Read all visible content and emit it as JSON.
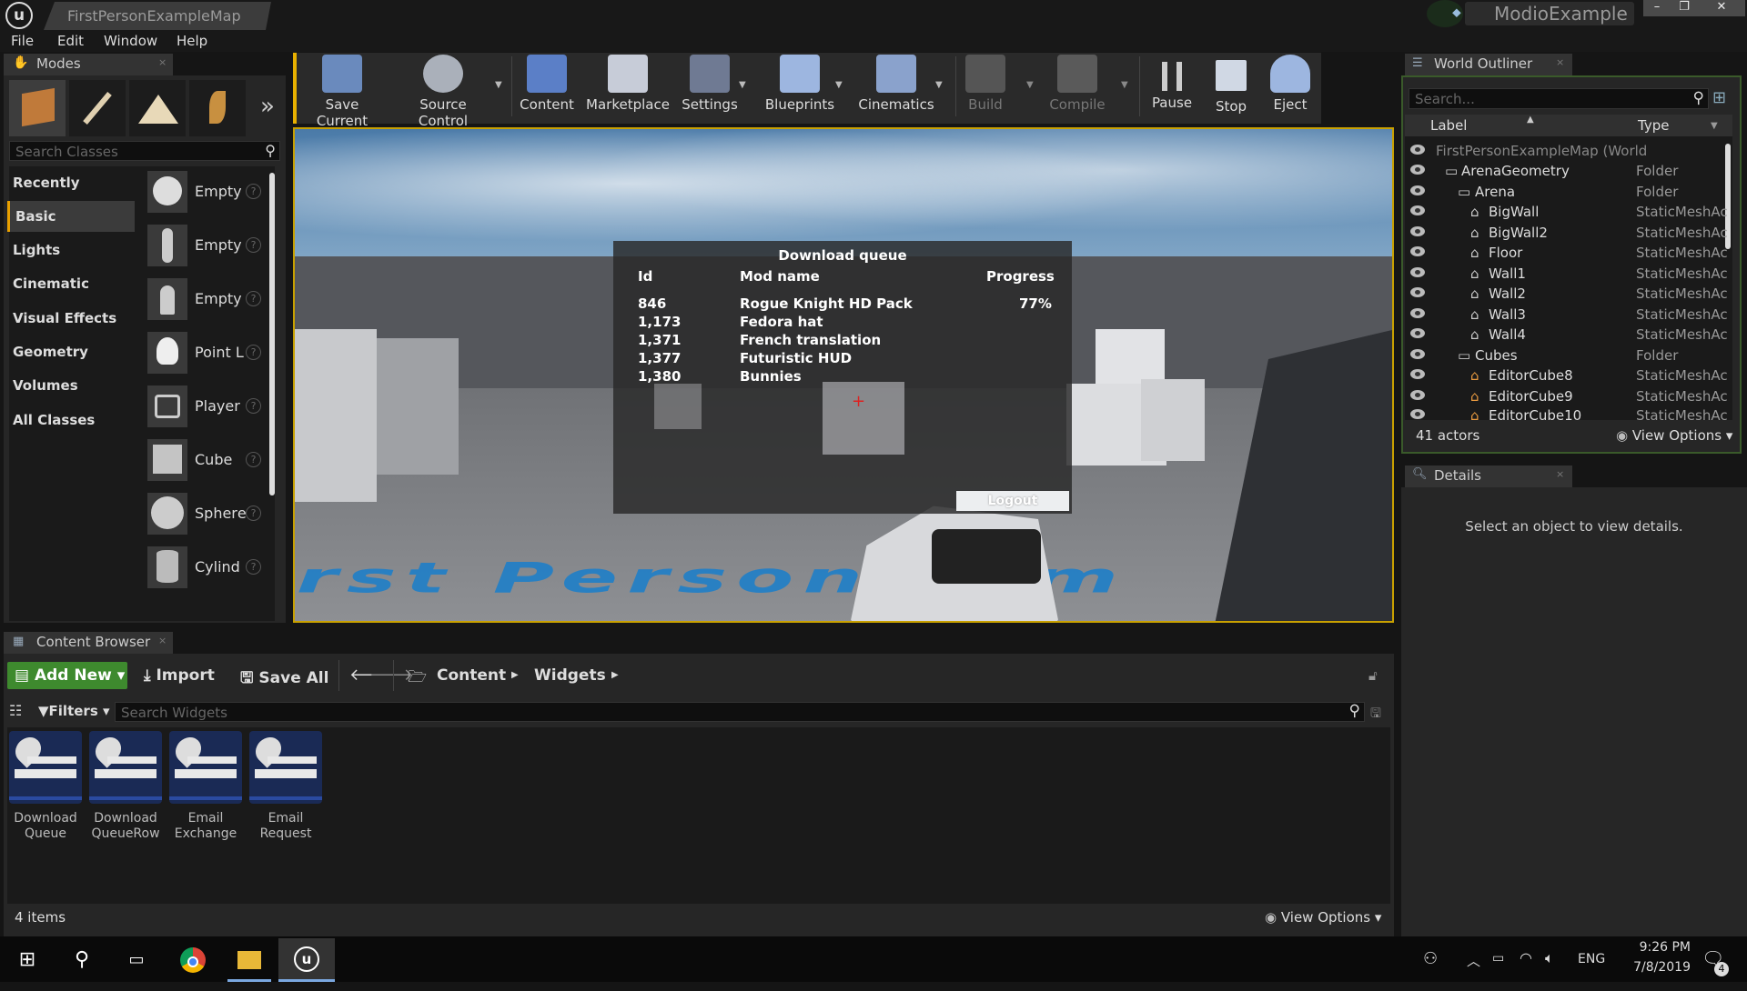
{
  "window": {
    "tab_title": "FirstPersonExampleMap",
    "project": "ModioExample"
  },
  "menu": [
    "File",
    "Edit",
    "Window",
    "Help"
  ],
  "modes": {
    "header": "Modes",
    "search_placeholder": "Search Classes",
    "categories": [
      "Recently Placed",
      "Basic",
      "Lights",
      "Cinematic",
      "Visual Effects",
      "Geometry",
      "Volumes",
      "All Classes"
    ],
    "selected_category": "Basic",
    "items": [
      "Empty",
      "Empty",
      "Empty",
      "Point L",
      "Player",
      "Cube",
      "Spherе",
      "Cylind"
    ]
  },
  "toolbar": {
    "buttons": [
      "Save Current",
      "Source Control",
      "Content",
      "Marketplace",
      "Settings",
      "Blueprints",
      "Cinematics",
      "Build",
      "Compile",
      "Pause",
      "Stop",
      "Eject"
    ]
  },
  "viewport": {
    "floor_text": "irst Person Tem",
    "download_queue": {
      "title": "Download queue",
      "columns": [
        "Id",
        "Mod name",
        "Progress"
      ],
      "rows": [
        {
          "id": "846",
          "name": "Rogue Knight HD Pack",
          "progress": "77%"
        },
        {
          "id": "1,173",
          "name": "Fedora hat",
          "progress": ""
        },
        {
          "id": "1,371",
          "name": "French translation",
          "progress": ""
        },
        {
          "id": "1,377",
          "name": "Futuristic HUD",
          "progress": ""
        },
        {
          "id": "1,380",
          "name": "Bunnies",
          "progress": ""
        }
      ],
      "logout_label": "Logout"
    }
  },
  "outliner": {
    "header": "World Outliner",
    "search_placeholder": "Search...",
    "col_label": "Label",
    "col_type": "Type",
    "rows": [
      {
        "label": "FirstPersonExampleMap (World",
        "type": ""
      },
      {
        "label": "ArenaGeometry",
        "type": "Folder"
      },
      {
        "label": "Arena",
        "type": "Folder"
      },
      {
        "label": "BigWall",
        "type": "StaticMeshAc"
      },
      {
        "label": "BigWall2",
        "type": "StaticMeshAc"
      },
      {
        "label": "Floor",
        "type": "StaticMeshAc"
      },
      {
        "label": "Wall1",
        "type": "StaticMeshAc"
      },
      {
        "label": "Wall2",
        "type": "StaticMeshAc"
      },
      {
        "label": "Wall3",
        "type": "StaticMeshAc"
      },
      {
        "label": "Wall4",
        "type": "StaticMeshAc"
      },
      {
        "label": "Cubes",
        "type": "Folder"
      },
      {
        "label": "EditorCube8",
        "type": "StaticMeshAc"
      },
      {
        "label": "EditorCube9",
        "type": "StaticMeshAc"
      },
      {
        "label": "EditorCube10",
        "type": "StaticMeshAc"
      }
    ],
    "actor_count": "41 actors",
    "view_options": "View Options"
  },
  "details": {
    "header": "Details",
    "empty_message": "Select an object to view details."
  },
  "content_browser": {
    "header": "Content Browser",
    "add_new": "Add New",
    "import": "Import",
    "save_all": "Save All",
    "path": [
      "Content",
      "Widgets"
    ],
    "filters": "Filters",
    "search_placeholder": "Search Widgets",
    "assets": [
      "Download\nQueue",
      "Download\nQueueRow",
      "Email\nExchange",
      "Email\nRequest"
    ],
    "item_count": "4 items",
    "view_options": "View Options"
  },
  "taskbar": {
    "lang": "ENG",
    "time": "9:26 PM",
    "date": "7/8/2019",
    "notifications": "4"
  }
}
